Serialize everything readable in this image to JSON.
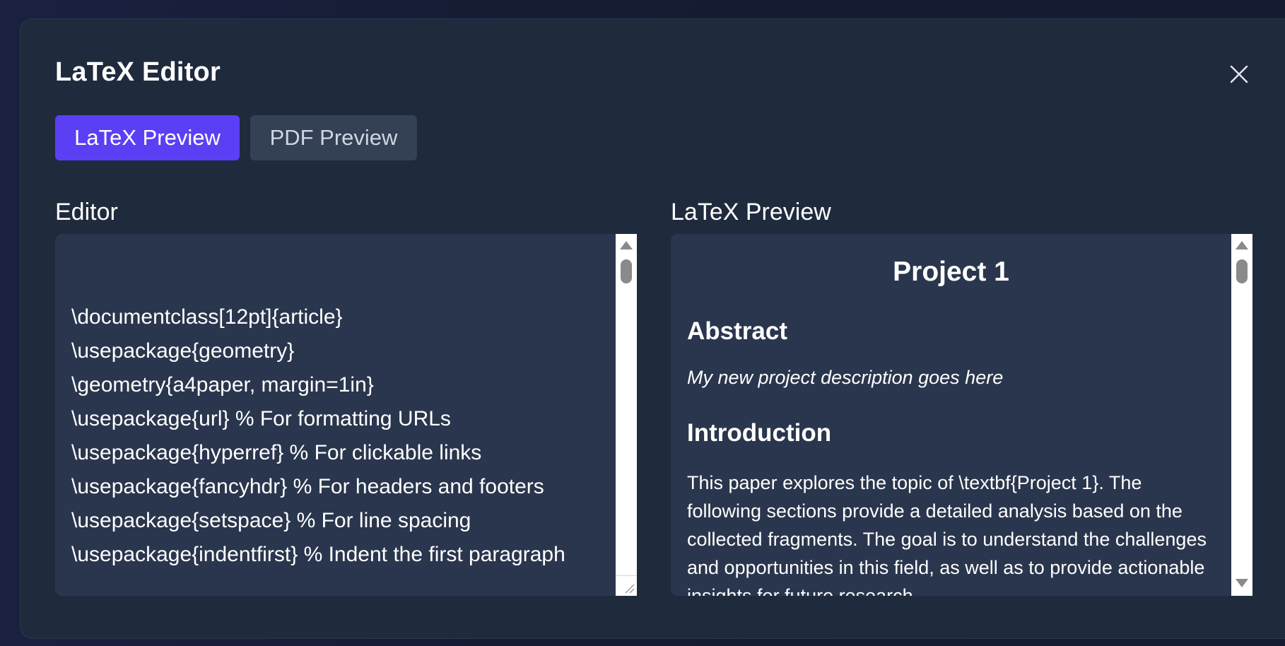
{
  "dialog": {
    "title": "LaTeX Editor",
    "close_icon": "close-icon"
  },
  "tabs": [
    {
      "label": "LaTeX Preview",
      "active": true,
      "color": "#5b3ff5"
    },
    {
      "label": "PDF Preview",
      "active": false,
      "color": "#334055"
    }
  ],
  "editor": {
    "heading": "Editor",
    "content": "\n\\documentclass[12pt]{article}\n\\usepackage{geometry}\n\\geometry{a4paper, margin=1in}\n\\usepackage{url} % For formatting URLs\n\\usepackage{hyperref} % For clickable links\n\\usepackage{fancyhdr} % For headers and footers\n\\usepackage{setspace} % For line spacing\n\\usepackage{indentfirst} % Indent the first paragraph"
  },
  "preview": {
    "heading": "LaTeX Preview",
    "title": "Project 1",
    "abstract_heading": "Abstract",
    "abstract_text": "My new project description goes here",
    "intro_heading": "Introduction",
    "intro_text": "This paper explores the topic of \\textbf{Project 1}. The following sections provide a detailed analysis based on the collected fragments. The goal is to understand the challenges and opportunities in this field, as well as to provide actionable insights for future research."
  },
  "colors": {
    "accent": "#5b3ff5",
    "panel_bg": "#2a364d",
    "modal_bg": "#1f2a3d"
  }
}
